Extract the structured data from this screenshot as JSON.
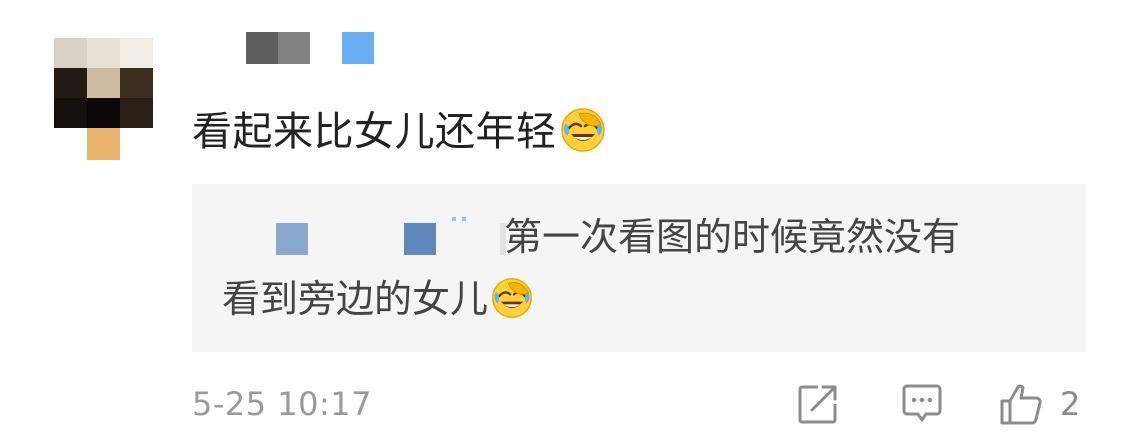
{
  "comment": {
    "text": "看起来比女儿还年轻",
    "emoji": "laughing-crying-emoji"
  },
  "reply": {
    "line1": "第一次看图的时候竟然没有",
    "line2": "看到旁边的女儿",
    "emoji": "laughing-crying-emoji"
  },
  "footer": {
    "timestamp": "5-25 10:17",
    "like_count": "2"
  },
  "icons": {
    "share": "share-icon",
    "reply": "comment-icon",
    "like": "thumbs-up-icon"
  },
  "colors": {
    "text_primary": "#222222",
    "text_secondary": "#9a9a9a",
    "reply_bg": "#f5f5f5",
    "username_accent": "#6aaef5"
  }
}
